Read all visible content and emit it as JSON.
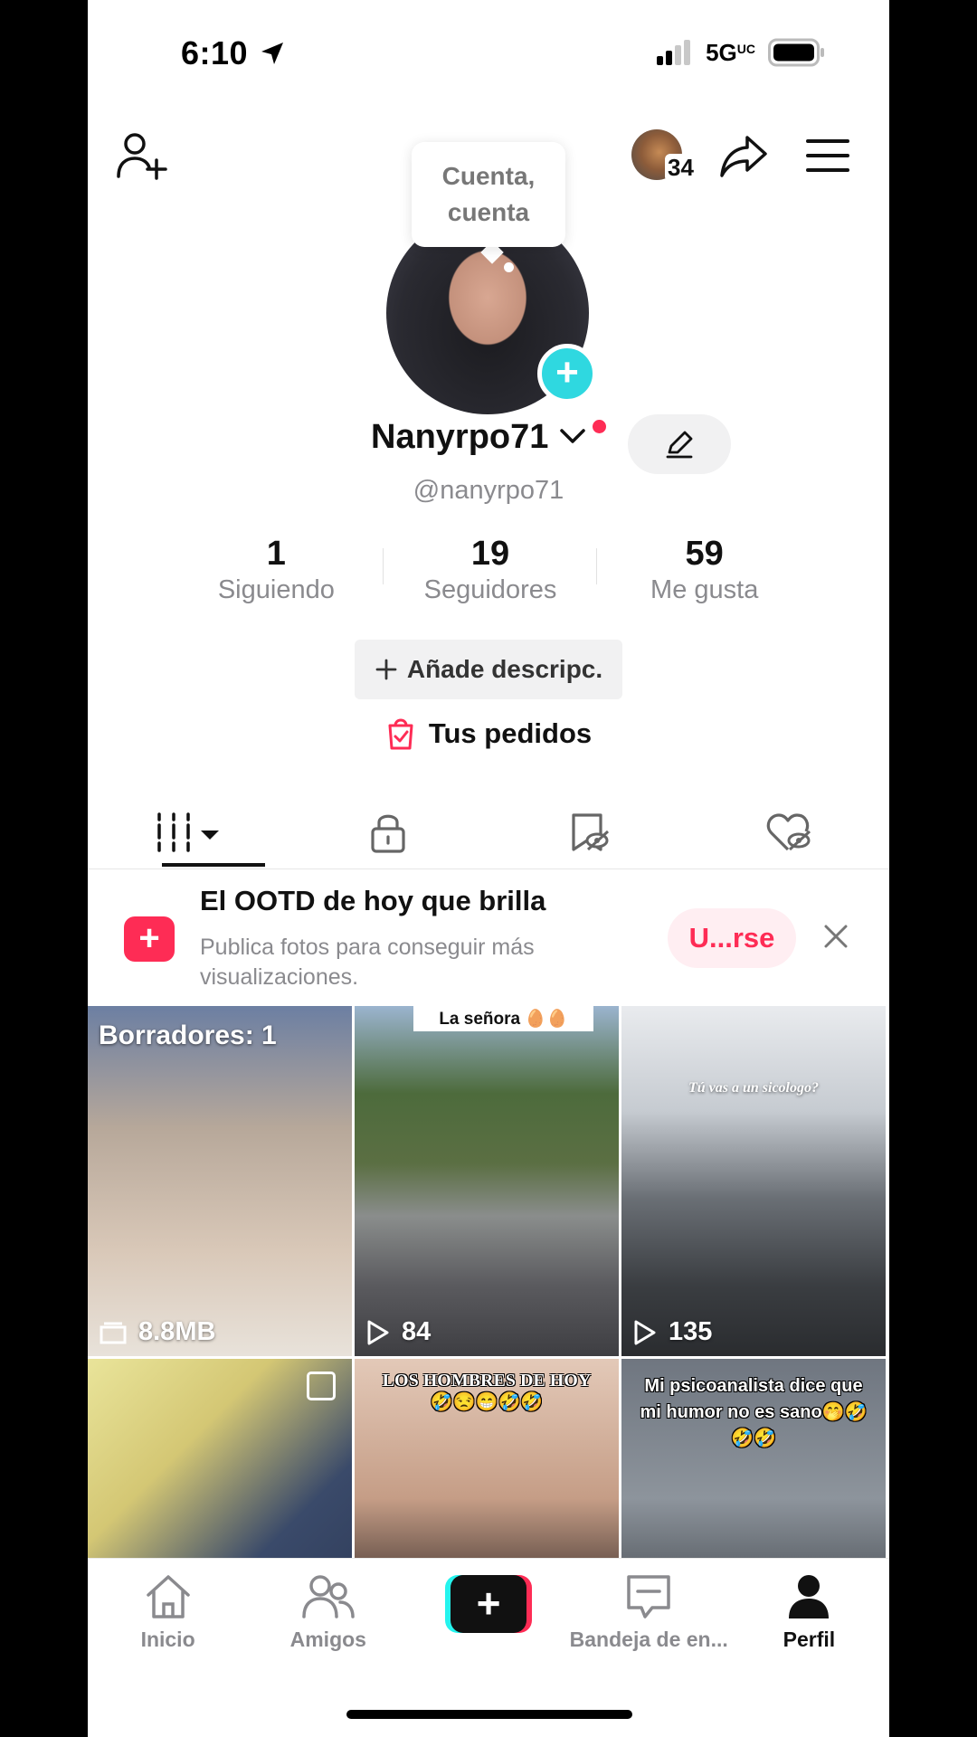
{
  "status_bar": {
    "time": "6:10",
    "network": "5G",
    "network_suffix": "UC"
  },
  "header": {
    "friends_count": "34"
  },
  "tooltip": {
    "text": "Cuenta, cuenta"
  },
  "profile": {
    "display_name": "Nanyrpo71",
    "handle": "@nanyrpo71",
    "stats": [
      {
        "value": "1",
        "label": "Siguiendo"
      },
      {
        "value": "19",
        "label": "Seguidores"
      },
      {
        "value": "59",
        "label": "Me gusta"
      }
    ],
    "add_bio_label": "Añade descripc.",
    "orders_label": "Tus pedidos"
  },
  "promo": {
    "title": "El OOTD de hoy que brilla",
    "subtitle": "Publica fotos para conseguir más visualizaciones.",
    "button_label": "U...rse"
  },
  "grid": [
    {
      "overlay_top": "Borradores: 1",
      "meta": "8.8MB",
      "meta_icon": "folder-icon"
    },
    {
      "overlay_top": "La señora 🥚🥚",
      "meta": "84",
      "meta_icon": "play-icon"
    },
    {
      "overlay_top": "Tú vas a un sicologo?",
      "meta": "135",
      "meta_icon": "play-icon"
    },
    {
      "overlay_top": "",
      "meta": "",
      "meta_icon": "photo-icon"
    },
    {
      "overlay_top": "LOS HOMBRES DE HOY 🤣😒😁🤣🤣",
      "meta": "",
      "meta_icon": ""
    },
    {
      "overlay_top": "Mi psicoanalista dice que mi humor no es sano🤭🤣🤣🤣",
      "meta": "",
      "meta_icon": ""
    }
  ],
  "bottom_nav": [
    {
      "label": "Inicio",
      "icon": "home-icon"
    },
    {
      "label": "Amigos",
      "icon": "friends-icon"
    },
    {
      "label": "",
      "icon": "create-icon"
    },
    {
      "label": "Bandeja de en...",
      "icon": "inbox-icon"
    },
    {
      "label": "Perfil",
      "icon": "profile-icon"
    }
  ],
  "colors": {
    "accent": "#fe2c55",
    "teal": "#2fd8e0",
    "muted": "#8a8a8e"
  }
}
